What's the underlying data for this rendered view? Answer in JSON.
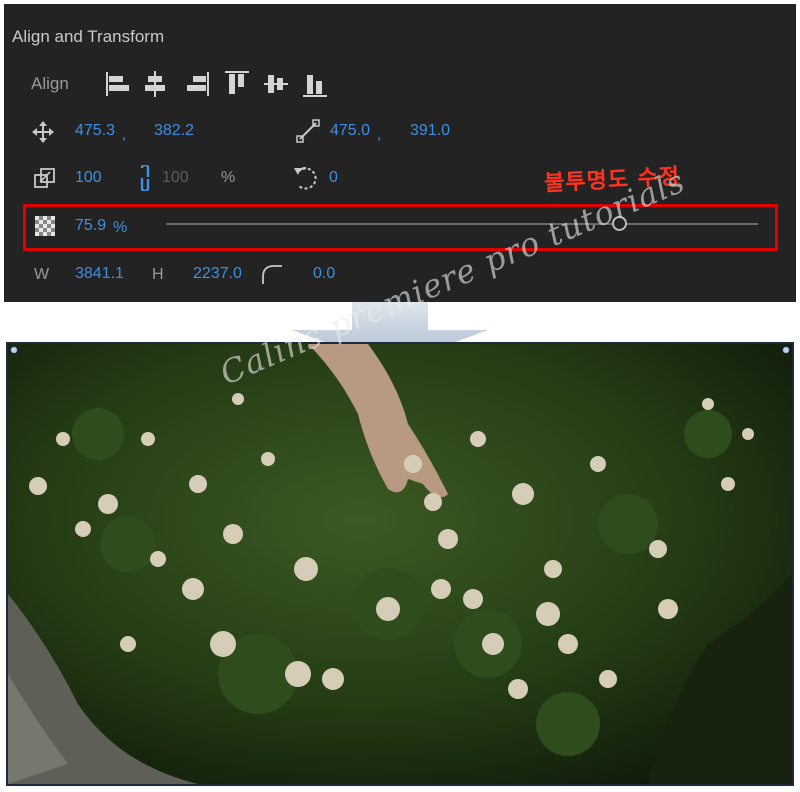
{
  "panel": {
    "title": "Align and Transform",
    "align_label": "Align",
    "align_buttons": [
      "align-left-icon",
      "align-horizontal-center-icon",
      "align-right-icon",
      "align-top-icon",
      "align-vertical-center-icon",
      "align-bottom-icon"
    ],
    "position": {
      "x": "475.3",
      "sep": ",",
      "y": "382.2"
    },
    "anchor": {
      "x": "475.0",
      "sep": ",",
      "y": "391.0"
    },
    "scale": {
      "width": "100",
      "height": "100",
      "unit": "%"
    },
    "rotation": "0",
    "opacity": {
      "value": "75.9",
      "unit": "%",
      "level": 0.759
    },
    "size": {
      "w_label": "W",
      "w": "3841.1",
      "h_label": "H",
      "h": "2237.0",
      "corner_radius": "0.0"
    }
  },
  "annotation": "불투명도 수정",
  "watermark": "Calins premiere pro tutorials",
  "colors": {
    "accent": "#3d8fe3",
    "highlight": "#e00000",
    "annotation": "#ff3322",
    "panel_bg": "#232323"
  }
}
